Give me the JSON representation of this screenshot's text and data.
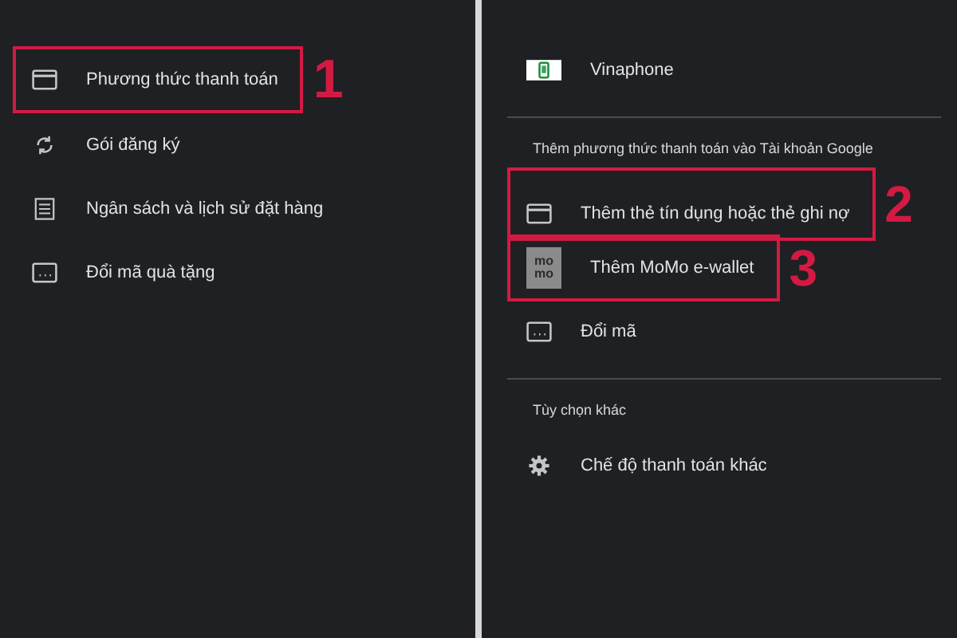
{
  "left_menu": [
    {
      "kind": "card",
      "label": "Phương thức thanh toán",
      "highlighted": true,
      "callout": "1"
    },
    {
      "kind": "sync",
      "label": "Gói đăng ký",
      "highlighted": false
    },
    {
      "kind": "list",
      "label": "Ngân sách và lịch sử đặt hàng",
      "highlighted": false
    },
    {
      "kind": "code",
      "label": "Đổi mã quà tặng",
      "highlighted": false
    }
  ],
  "right_panel": {
    "current_methods": [
      {
        "kind": "phone",
        "label": "Vinaphone",
        "highlighted": false
      }
    ],
    "sections": [
      {
        "heading": "Thêm phương thức thanh toán vào Tài khoản Google",
        "items": [
          {
            "kind": "card",
            "label": "Thêm thẻ tín dụng hoặc thẻ ghi nợ",
            "highlighted": true,
            "callout": "2"
          },
          {
            "kind": "wallet",
            "logo_lines": [
              "mo",
              "mo"
            ],
            "label": "Thêm MoMo e-wallet",
            "highlighted": true,
            "callout": "3"
          },
          {
            "kind": "code",
            "label": "Đổi mã",
            "highlighted": false
          }
        ]
      },
      {
        "heading": "Tùy chọn khác",
        "items": [
          {
            "kind": "settings",
            "label": "Chế độ thanh toán khác",
            "highlighted": false
          }
        ]
      }
    ]
  }
}
